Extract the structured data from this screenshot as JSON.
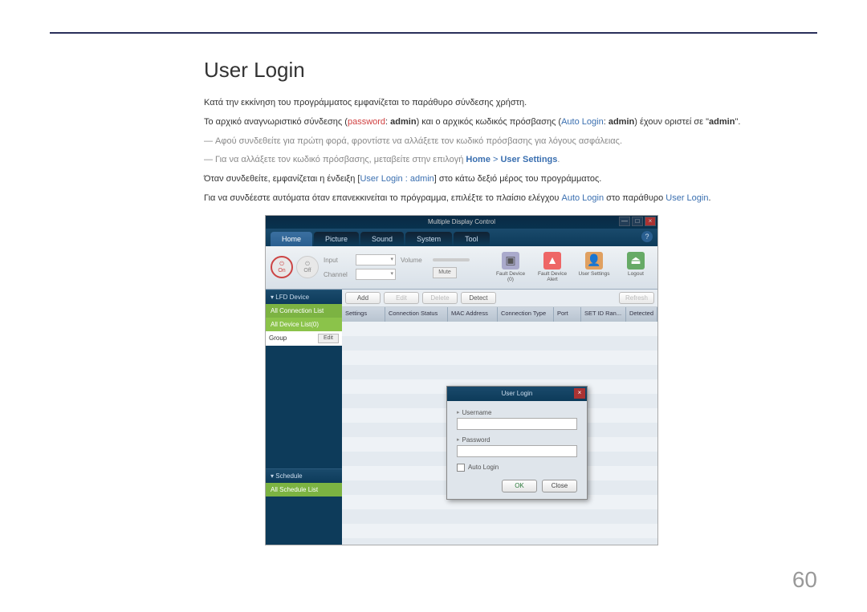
{
  "heading": "User Login",
  "para1": "Κατά την εκκίνηση του προγράμματος εμφανίζεται το παράθυρο σύνδεσης χρήστη.",
  "para2_a": "Το αρχικό αναγνωριστικό σύνδεσης (",
  "para2_pw": "password",
  "para2_b": ": ",
  "para2_admin1": "admin",
  "para2_c": ") και ο αρχικός κωδικός πρόσβασης (",
  "para2_al": "Auto Login",
  "para2_d": ": ",
  "para2_admin2": "admin",
  "para2_e": ") έχουν οριστεί σε \"",
  "para2_admin3": "admin",
  "para2_f": "\".",
  "note1": "Αφού συνδεθείτε για πρώτη φορά, φροντίστε να αλλάξετε τον κωδικό πρόσβασης για λόγους ασφάλειας.",
  "note2_a": "Για να αλλάξετε τον κωδικό πρόσβασης, μεταβείτε στην επιλογή ",
  "note2_home": "Home",
  "note2_gt": " > ",
  "note2_us": "User Settings",
  "note2_b": ".",
  "para3_a": "Όταν συνδεθείτε, εμφανίζεται η ένδειξη [",
  "para3_ul": "User Login : admin",
  "para3_b": "] στο κάτω δεξιό μέρος του προγράμματος.",
  "para4_a": "Για να συνδέεστε αυτόματα όταν επανεκκινείται το πρόγραμμα, επιλέξτε το πλαίσιο ελέγχου ",
  "para4_al": "Auto Login",
  "para4_b": " στο παράθυρο ",
  "para4_ul": "User Login",
  "para4_c": ".",
  "app": {
    "title": "Multiple Display Control",
    "tabs": [
      "Home",
      "Picture",
      "Sound",
      "System",
      "Tool"
    ],
    "help": "?",
    "power_on": "On",
    "power_off": "Off",
    "dd_input": "Input",
    "dd_channel": "Channel",
    "dd_volume": "Volume",
    "btn_mute": "Mute",
    "ricons": [
      {
        "label": "Fault Device (0)",
        "glyph": "▣"
      },
      {
        "label": "Fault Device Alert",
        "glyph": "▲"
      },
      {
        "label": "User Settings",
        "glyph": "👤"
      },
      {
        "label": "Logout",
        "glyph": "⏏"
      }
    ],
    "side_lfd": "LFD Device",
    "side_allconn": "All Connection List",
    "side_alldev": "All Device List(0)",
    "side_group": "Group",
    "side_edit": "Edit",
    "side_schedule": "Schedule",
    "side_allsched": "All Schedule List",
    "act_add": "Add",
    "act_edit": "Edit",
    "act_delete": "Delete",
    "act_detect": "Detect",
    "act_refresh": "Refresh",
    "cols": [
      "Settings",
      "Connection Status",
      "MAC Address",
      "Connection Type",
      "Port",
      "SET ID Ran...",
      "Detected"
    ],
    "dlg_title": "User Login",
    "dlg_user": "Username",
    "dlg_pass": "Password",
    "dlg_auto": "Auto Login",
    "dlg_ok": "OK",
    "dlg_close": "Close"
  },
  "pagenum": "60"
}
